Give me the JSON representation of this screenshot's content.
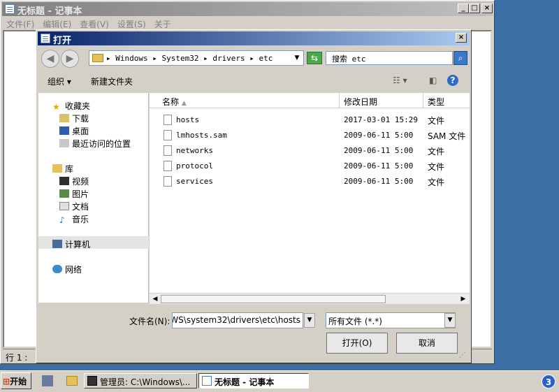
{
  "notepad": {
    "title": "无标题 - 记事本",
    "menu": [
      "文件(F)",
      "编辑(E)",
      "查看(V)",
      "设置(S)",
      "关于"
    ],
    "status": "行 1 :"
  },
  "dialog": {
    "title": "打开",
    "address_crumbs": "▸ Windows ▸ System32 ▸ drivers ▸ etc",
    "search_placeholder": "搜索 etc",
    "toolbar": {
      "organize": "组织 ▾",
      "new_folder": "新建文件夹"
    },
    "nav": {
      "favorites": "收藏夹",
      "downloads": "下载",
      "desktop": "桌面",
      "recent": "最近访问的位置",
      "libraries": "库",
      "videos": "视频",
      "pictures": "图片",
      "documents": "文档",
      "music": "音乐",
      "computer": "计算机",
      "network": "网络"
    },
    "columns": {
      "name": "名称",
      "date": "修改日期",
      "type": "类型"
    },
    "files": [
      {
        "name": "hosts",
        "date": "2017-03-01 15:29",
        "type": "文件"
      },
      {
        "name": "lmhosts.sam",
        "date": "2009-06-11 5:00",
        "type": "SAM 文件"
      },
      {
        "name": "networks",
        "date": "2009-06-11 5:00",
        "type": "文件"
      },
      {
        "name": "protocol",
        "date": "2009-06-11 5:00",
        "type": "文件"
      },
      {
        "name": "services",
        "date": "2009-06-11 5:00",
        "type": "文件"
      }
    ],
    "filename_label": "文件名(N):",
    "filename_value": ")WS\\system32\\drivers\\etc\\hosts",
    "filetype_value": "所有文件 (*.*)",
    "open_button": "打开(O)",
    "cancel_button": "取消"
  },
  "taskbar": {
    "start": "开始",
    "tasks": [
      "管理员: C:\\Windows\\...",
      "无标题 - 记事本"
    ],
    "tray_badge": "3"
  },
  "colors": {
    "desktop": "#3a6ea5",
    "dialog_title": "#0a246a",
    "window_face": "#d4d0c8"
  }
}
